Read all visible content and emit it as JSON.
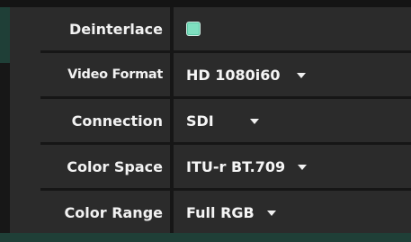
{
  "settings": {
    "deinterlace": {
      "label": "Deinterlace",
      "checked": true,
      "checkbox_color": "#7fe0c0"
    },
    "video_format": {
      "label": "Video Format",
      "value": "HD 1080i60"
    },
    "connection": {
      "label": "Connection",
      "value": "SDI"
    },
    "color_space": {
      "label": "Color Space",
      "value": "ITU-r BT.709"
    },
    "color_range": {
      "label": "Color Range",
      "value": "Full RGB"
    }
  },
  "icons": {
    "dropdown": "chevron-down-icon"
  }
}
